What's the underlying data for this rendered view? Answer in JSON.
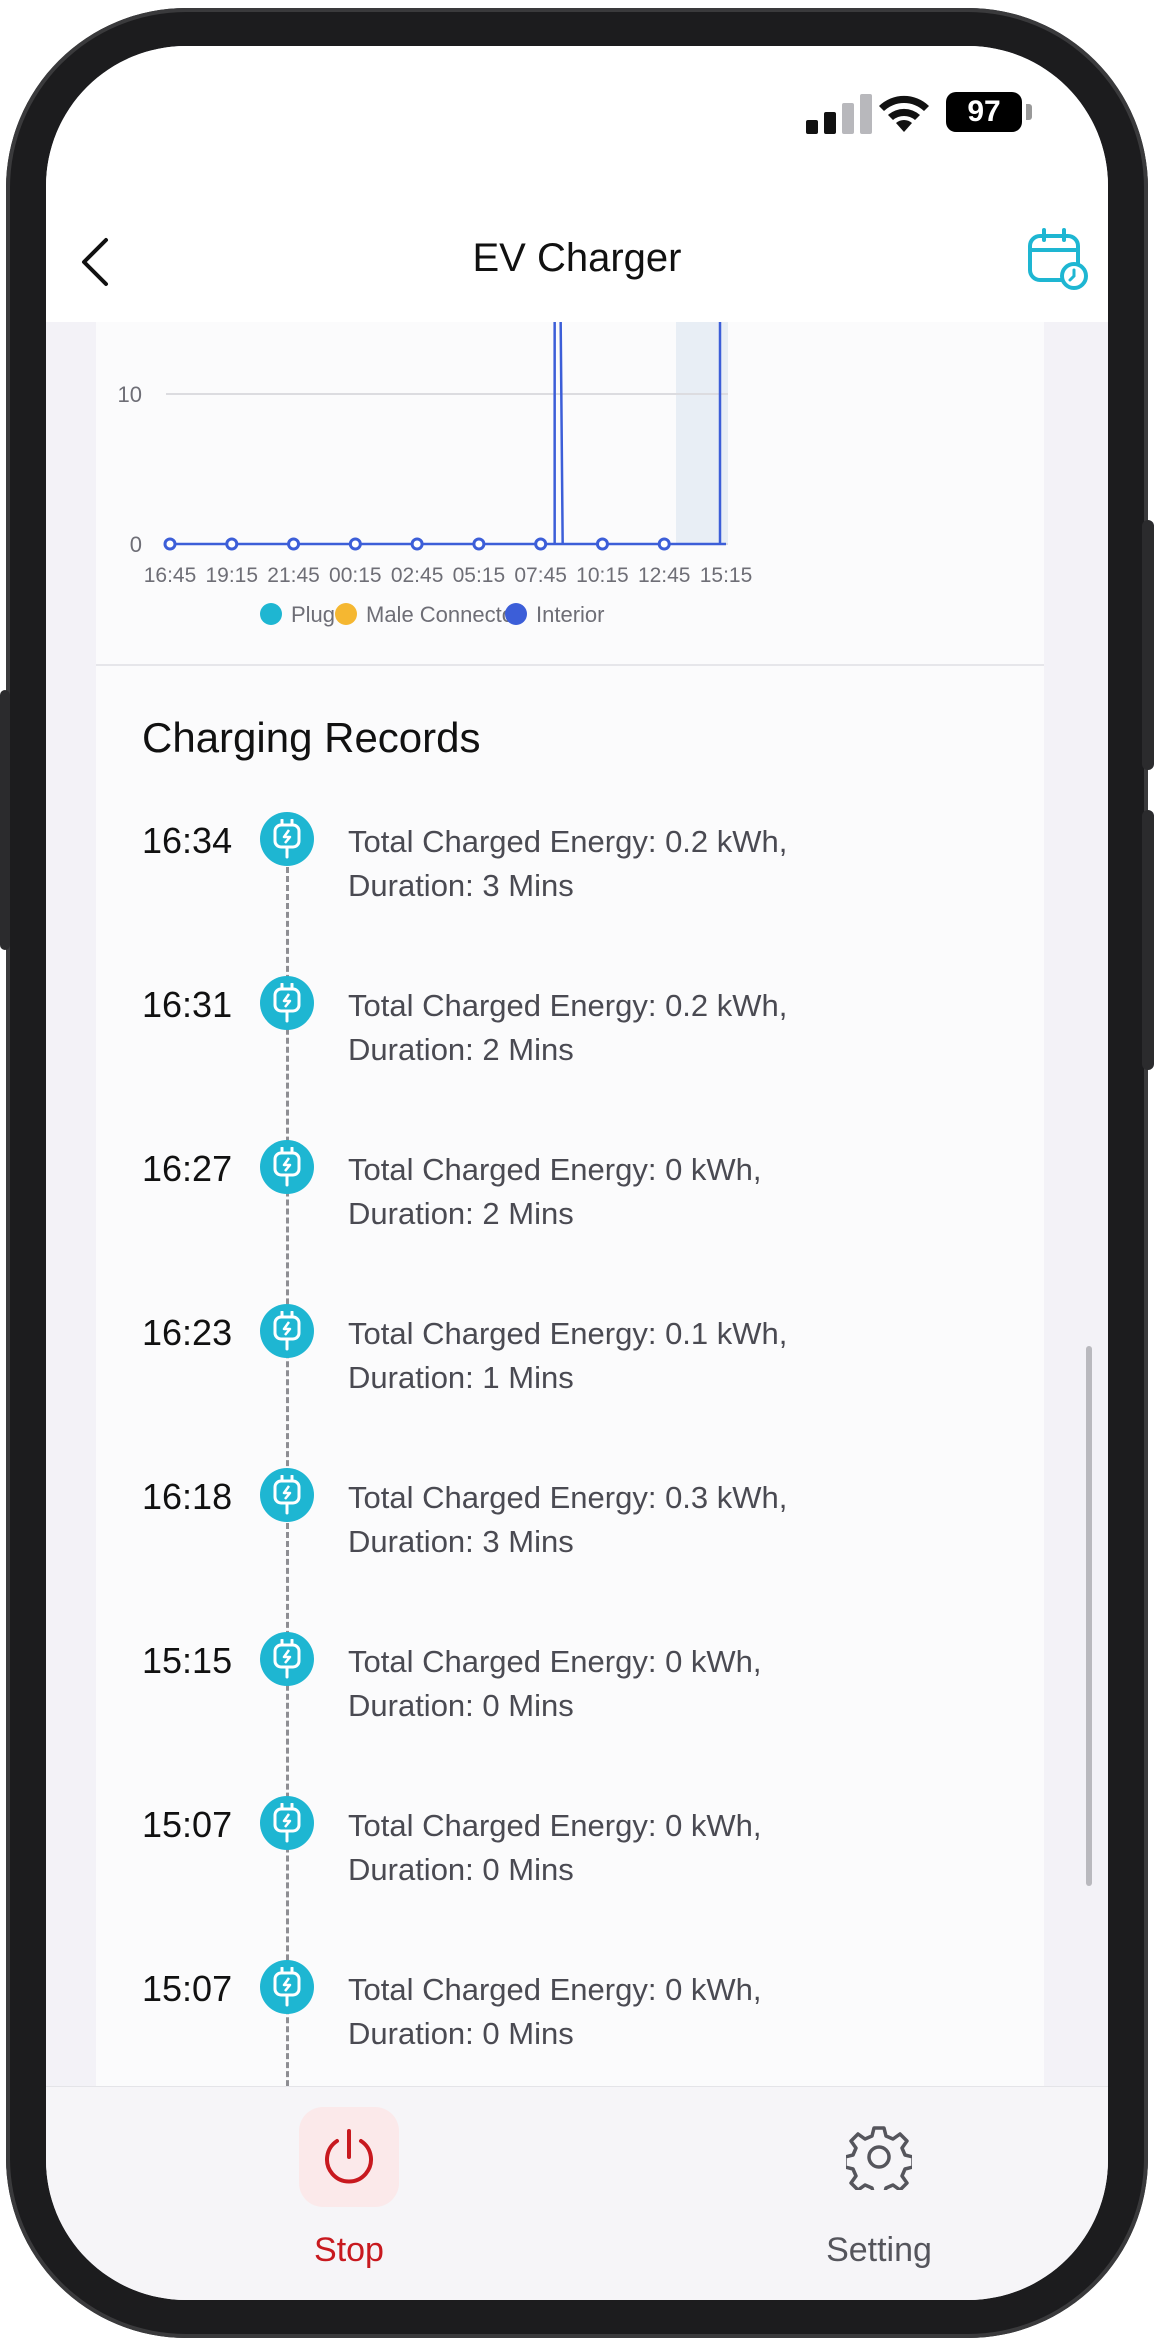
{
  "status_bar": {
    "battery": "97"
  },
  "header": {
    "title": "EV Charger"
  },
  "chart_data": {
    "type": "line",
    "x": [
      "16:45",
      "19:15",
      "21:45",
      "00:15",
      "02:45",
      "05:15",
      "07:45",
      "10:15",
      "12:45",
      "15:15"
    ],
    "yticks": [
      "0",
      "10"
    ],
    "series": [
      {
        "name": "Plug",
        "color": "#1eb6d2",
        "values": [
          0,
          0,
          0,
          0,
          0,
          0,
          0,
          0,
          0,
          0
        ]
      },
      {
        "name": "Male Connector",
        "color": "#f5b731",
        "values": [
          0,
          0,
          0,
          0,
          0,
          0,
          0,
          0,
          0,
          0
        ]
      },
      {
        "name": "Interior",
        "color": "#3c5ed8",
        "values": [
          0,
          0,
          0,
          0,
          0,
          0,
          0,
          0,
          0,
          0
        ]
      }
    ],
    "legend": [
      "Plug",
      "Male Connector",
      "Interior"
    ],
    "grid": true,
    "legend_position": "bottom"
  },
  "records_title": "Charging Records",
  "records": [
    {
      "time": "16:34",
      "energy": "Total Charged Energy: 0.2 kWh,",
      "duration": "Duration: 3 Mins"
    },
    {
      "time": "16:31",
      "energy": "Total Charged Energy: 0.2 kWh,",
      "duration": "Duration: 2 Mins"
    },
    {
      "time": "16:27",
      "energy": "Total Charged Energy: 0 kWh,",
      "duration": "Duration: 2 Mins"
    },
    {
      "time": "16:23",
      "energy": "Total Charged Energy: 0.1 kWh,",
      "duration": "Duration: 1 Mins"
    },
    {
      "time": "16:18",
      "energy": "Total Charged Energy: 0.3 kWh,",
      "duration": "Duration: 3 Mins"
    },
    {
      "time": "15:15",
      "energy": "Total Charged Energy: 0 kWh,",
      "duration": "Duration: 0 Mins"
    },
    {
      "time": "15:07",
      "energy": "Total Charged Energy: 0 kWh,",
      "duration": "Duration: 0 Mins"
    },
    {
      "time": "15:07",
      "energy": "Total Charged Energy: 0 kWh,",
      "duration": "Duration: 0 Mins"
    }
  ],
  "bottom_bar": {
    "stop_label": "Stop",
    "setting_label": "Setting",
    "stop_color": "#c8191f",
    "setting_color": "#55555c"
  },
  "colors": {
    "accent": "#1eb6d2"
  }
}
